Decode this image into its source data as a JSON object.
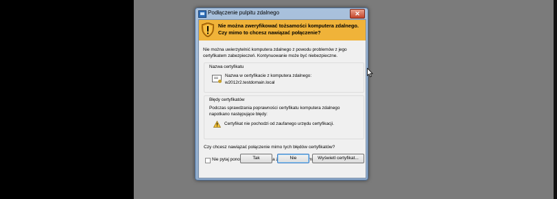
{
  "dialog": {
    "title": "Podłączenie pulpitu zdalnego",
    "close_symbol": "✕",
    "warning_line1": "Nie można zweryfikować tożsamości komputera zdalnego.",
    "warning_line2": "Czy mimo to chcesz nawiązać połączenie?",
    "description_line1": "Nie można uwierzytelnić komputera zdalnego z powodu problemów z jego",
    "description_line2": "certyfikatem zabezpieczeń. Kontynuowanie może być niebezpieczne.",
    "certificate_group": {
      "title": "Nazwa certyfikatu",
      "label": "Nazwa w certyfikacie z komputera zdalnego:",
      "value": "w2012r2.testdomain.local"
    },
    "errors_group": {
      "title": "Błędy certyfikatów",
      "desc_line1": "Podczas sprawdzania poprawności certyfikatu komputera zdalnego",
      "desc_line2": "napotkano następujące błędy:",
      "error": "Certyfikat nie pochodzi od zaufanego urzędu certyfikacji."
    },
    "question": "Czy chcesz nawiązać połączenie mimo tych błędów certyfikatów?",
    "checkbox_label": "Nie pytaj ponownie o połączenia z tym komputerem",
    "buttons": {
      "yes": "Tak",
      "no": "Nie",
      "view_cert": "Wyświetl certyfikat..."
    }
  },
  "colors": {
    "warning_bar": "#f0b339",
    "desktop": "#7b7b7b",
    "left_panel": "#000000"
  },
  "icons": [
    "app-icon",
    "close-icon",
    "shield-warning-icon",
    "certificate-icon",
    "warning-icon",
    "mouse-cursor-icon"
  ]
}
